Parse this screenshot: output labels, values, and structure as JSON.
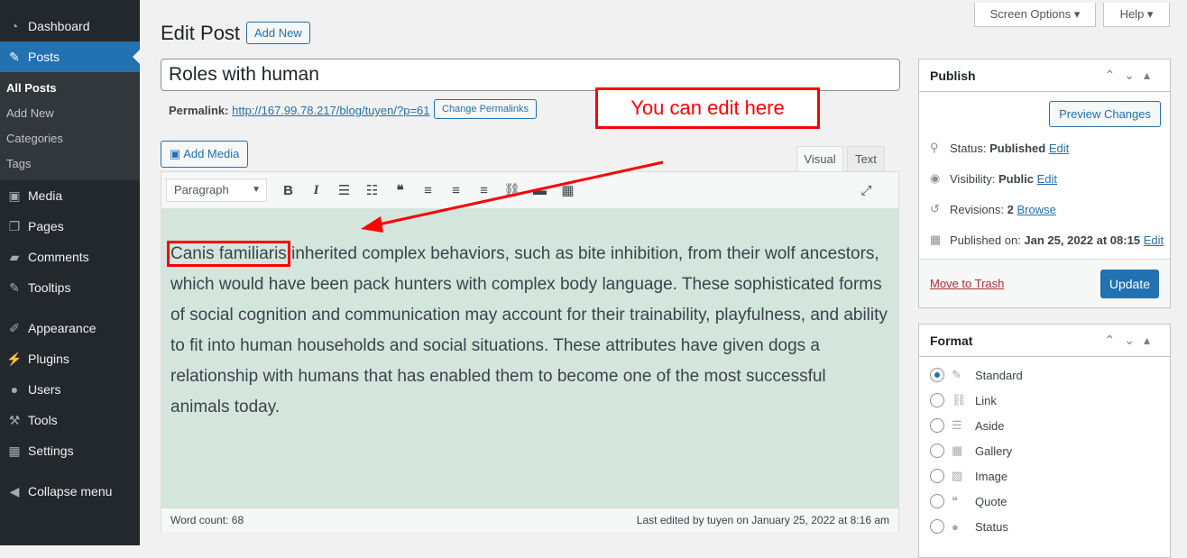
{
  "sidebar": {
    "items": [
      {
        "label": "Dashboard",
        "icon": "dashboard-icon",
        "glyph": "◔"
      },
      {
        "label": "Posts",
        "icon": "pin-icon",
        "glyph": "✎",
        "active": true
      },
      {
        "label": "Media",
        "icon": "media-icon",
        "glyph": "▣"
      },
      {
        "label": "Pages",
        "icon": "pages-icon",
        "glyph": "❐"
      },
      {
        "label": "Comments",
        "icon": "comment-icon",
        "glyph": "▰"
      },
      {
        "label": "Tooltips",
        "icon": "pin-icon",
        "glyph": "✎"
      },
      {
        "label": "Appearance",
        "icon": "brush-icon",
        "glyph": "✐"
      },
      {
        "label": "Plugins",
        "icon": "plugin-icon",
        "glyph": "⚡"
      },
      {
        "label": "Users",
        "icon": "user-icon",
        "glyph": "●"
      },
      {
        "label": "Tools",
        "icon": "wrench-icon",
        "glyph": "⚒"
      },
      {
        "label": "Settings",
        "icon": "settings-icon",
        "glyph": "▦"
      },
      {
        "label": "Collapse menu",
        "icon": "collapse-icon",
        "glyph": "◀"
      }
    ],
    "submenu": [
      "All Posts",
      "Add New",
      "Categories",
      "Tags"
    ]
  },
  "header": {
    "title": "Edit Post",
    "add_new": "Add New",
    "screen_options": "Screen Options ▾",
    "help": "Help ▾"
  },
  "post": {
    "title": "Roles with human",
    "permalink_label": "Permalink:",
    "permalink": "http://167.99.78.217/blog/tuyen/?p=61",
    "change_permalinks": "Change Permalinks"
  },
  "editor": {
    "add_media": "Add Media",
    "tab_visual": "Visual",
    "tab_text": "Text",
    "format_select": "Paragraph",
    "content_highlight": "Canis familiaris",
    "content": " inherited complex behaviors, such as bite inhibition, from their wolf ancestors, which would have been pack hunters with complex body language. These sophisticated forms of social cognition and communication may account for their trainability, playfulness, and ability to fit into human households and social situations. These attributes have given dogs a relationship with humans that has enabled them to become one of the most successful animals today.",
    "word_count": "Word count: 68",
    "last_edited": "Last edited by tuyen on January 25, 2022 at 8:16 am"
  },
  "annotation": {
    "text": "You can edit here",
    "color": "#ff0000"
  },
  "publish": {
    "title": "Publish",
    "preview": "Preview Changes",
    "status_label": "Status:",
    "status": "Published",
    "visibility_label": "Visibility:",
    "visibility": "Public",
    "revisions_label": "Revisions:",
    "revisions": "2",
    "browse": "Browse",
    "published_label": "Published on:",
    "published": "Jan 25, 2022 at 08:15",
    "edit": "Edit",
    "trash": "Move to Trash",
    "update": "Update"
  },
  "format": {
    "title": "Format",
    "options": [
      {
        "label": "Standard",
        "glyph": "✎",
        "selected": true
      },
      {
        "label": "Link",
        "glyph": "⛓"
      },
      {
        "label": "Aside",
        "glyph": "☰"
      },
      {
        "label": "Gallery",
        "glyph": "▦"
      },
      {
        "label": "Image",
        "glyph": "▨"
      },
      {
        "label": "Quote",
        "glyph": "❝"
      },
      {
        "label": "Status",
        "glyph": "●"
      }
    ]
  }
}
